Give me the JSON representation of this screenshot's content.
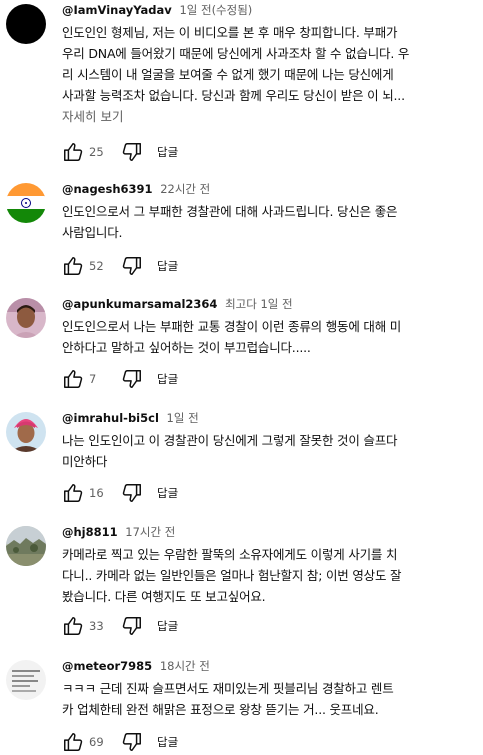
{
  "comments": [
    {
      "author": "@IamVinayYadav",
      "time": "1일 전(수정됨)",
      "lines": [
        "인도인인 형제님, 저는 이 비디오를 본 후 매우 창피합니다. 부패가",
        "우리 DNA에 들어왔기 때문에 당신에게 사과조차 할 수 없습니다. 우",
        "리 시스템이 내 얼굴을 보여줄 수 없게 했기 때문에 나는 당신에게",
        "사과할 능력조차 없습니다. 당신과 함께 우리도 당신이 받은 이 뇌..."
      ],
      "more": "자세히 보기",
      "likes": "25",
      "reply": "답글",
      "avatar": "black-circle"
    },
    {
      "author": "@nagesh6391",
      "time": "22시간 전",
      "lines": [
        "인도인으로서 그 부패한 경찰관에 대해 사과드립니다. 당신은 좋은",
        "사람입니다."
      ],
      "likes": "52",
      "reply": "답글",
      "avatar": "india-flag"
    },
    {
      "author": "@apunkumarsamal2364",
      "time": "최고다 1일 전",
      "lines": [
        "인도인으로서 나는 부패한 교통 경찰이 이런 종류의 행동에 대해 미",
        "안하다고 말하고 싶어하는 것이 부끄럽습니다....."
      ],
      "likes": "7",
      "reply": "답글",
      "avatar": "person-photo"
    },
    {
      "author": "@imrahul-bi5cl",
      "time": "1일 전",
      "lines": [
        "나는 인도인이고 이 경찰관이 당신에게 그렇게 잘못한 것이 슬프다",
        "미안하다"
      ],
      "likes": "16",
      "reply": "답글",
      "avatar": "person-turban-photo"
    },
    {
      "author": "@hj8811",
      "time": "17시간 전",
      "lines": [
        "카메라로 찍고 있는 우람한 팔뚝의 소유자에게도 이렇게 사기를 치",
        "다니.. 카메라 없는 일반인들은 얼마나 험난할지 참; 이번 영상도 잘",
        "봤습니다. 다른 여행지도 또 보고싶어요."
      ],
      "likes": "33",
      "reply": "답글",
      "avatar": "landscape-photo"
    },
    {
      "author": "@meteor7985",
      "time": "18시간 전",
      "lines": [
        "ㅋㅋㅋ 근데 진짜 슬프면서도 재미있는게 핏블리님 경찰하고 렌트",
        "카 업체한테 완전 해맑은 표정으로 왕창 뜯기는 거... 웃프네요."
      ],
      "likes": "69",
      "reply": "답글",
      "avatar": "text-image"
    }
  ]
}
